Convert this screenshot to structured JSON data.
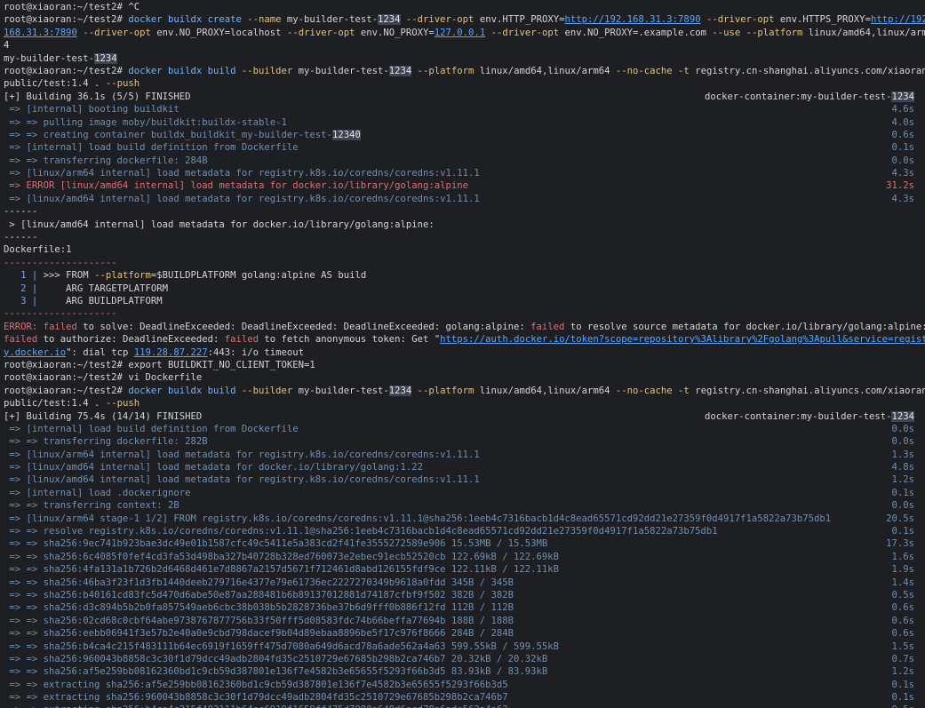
{
  "terminal": {
    "lines": [
      {
        "segs": [
          {
            "t": "root@xiaoran:~/test2# ",
            "c": "prompt"
          },
          {
            "t": "^C",
            "c": "plain"
          }
        ]
      },
      {
        "segs": [
          {
            "t": "root@xiaoran:~/test2# ",
            "c": "prompt"
          },
          {
            "t": "docker buildx create ",
            "c": "cmd"
          },
          {
            "t": "--name",
            "c": "opt"
          },
          {
            "t": " my-builder-test-",
            "c": "plain"
          },
          {
            "t": "1234",
            "c": "hl"
          },
          {
            "t": " ",
            "c": "plain"
          },
          {
            "t": "--driver-opt",
            "c": "opt"
          },
          {
            "t": " env.HTTP_PROXY=",
            "c": "plain"
          },
          {
            "t": "http://192.168.31.3:7890",
            "c": "url"
          },
          {
            "t": " ",
            "c": "plain"
          },
          {
            "t": "--driver-opt",
            "c": "opt"
          },
          {
            "t": " env.HTTPS_PROXY=",
            "c": "plain"
          },
          {
            "t": "http://192.",
            "c": "url"
          }
        ]
      },
      {
        "segs": [
          {
            "t": "168.31.3:7890",
            "c": "url"
          },
          {
            "t": " ",
            "c": "plain"
          },
          {
            "t": "--driver-opt",
            "c": "opt"
          },
          {
            "t": " env.NO_PROXY=localhost ",
            "c": "plain"
          },
          {
            "t": "--driver-opt",
            "c": "opt"
          },
          {
            "t": " env.NO_PROXY=",
            "c": "plain"
          },
          {
            "t": "127.0.0.1",
            "c": "url"
          },
          {
            "t": " ",
            "c": "plain"
          },
          {
            "t": "--driver-opt",
            "c": "opt"
          },
          {
            "t": " env.NO_PROXY=.example.com ",
            "c": "plain"
          },
          {
            "t": "--use",
            "c": "opt"
          },
          {
            "t": " ",
            "c": "plain"
          },
          {
            "t": "--platform",
            "c": "opt"
          },
          {
            "t": " linux/amd64,linux/arm6",
            "c": "plain"
          }
        ]
      },
      {
        "segs": [
          {
            "t": "4",
            "c": "plain"
          }
        ]
      },
      {
        "segs": [
          {
            "t": "my-builder-test-",
            "c": "plain"
          },
          {
            "t": "1234",
            "c": "hl"
          }
        ]
      },
      {
        "segs": [
          {
            "t": "root@xiaoran:~/test2# ",
            "c": "prompt"
          },
          {
            "t": "docker buildx build ",
            "c": "cmd"
          },
          {
            "t": "--builder",
            "c": "opt"
          },
          {
            "t": " my-builder-test-",
            "c": "plain"
          },
          {
            "t": "1234",
            "c": "hl"
          },
          {
            "t": " ",
            "c": "plain"
          },
          {
            "t": "--platform",
            "c": "opt"
          },
          {
            "t": " linux/amd64,linux/arm64 ",
            "c": "plain"
          },
          {
            "t": "--no-cache",
            "c": "opt"
          },
          {
            "t": " ",
            "c": "plain"
          },
          {
            "t": "-t",
            "c": "opt"
          },
          {
            "t": " registry.cn-shanghai.aliyuncs.com/xiaoran_",
            "c": "plain"
          }
        ]
      },
      {
        "segs": [
          {
            "t": "public/test:1.4 . ",
            "c": "plain"
          },
          {
            "t": "--push",
            "c": "opt"
          }
        ]
      },
      {
        "segs": [
          {
            "t": "[+] Building 36.1s (5/5) FINISHED",
            "c": "plain"
          }
        ],
        "right": [
          {
            "t": "docker-container:my-builder-test-",
            "c": "plain"
          },
          {
            "t": "1234",
            "c": "hl"
          }
        ]
      },
      {
        "segs": [
          {
            "t": " => [internal] booting buildkit",
            "c": "step"
          }
        ],
        "right": [
          {
            "t": "4.6s",
            "c": "time"
          }
        ]
      },
      {
        "segs": [
          {
            "t": " => => pulling image moby/buildkit:buildx-stable-1",
            "c": "step"
          }
        ],
        "right": [
          {
            "t": "4.0s",
            "c": "time"
          }
        ]
      },
      {
        "segs": [
          {
            "t": " => => creating container buildx_buildkit_my-builder-test-",
            "c": "step"
          },
          {
            "t": "12340",
            "c": "hl"
          }
        ],
        "right": [
          {
            "t": "0.6s",
            "c": "time"
          }
        ]
      },
      {
        "segs": [
          {
            "t": " => [internal] load build definition from Dockerfile",
            "c": "step"
          }
        ],
        "right": [
          {
            "t": "0.1s",
            "c": "time"
          }
        ]
      },
      {
        "segs": [
          {
            "t": " => => transferring dockerfile: 284B",
            "c": "step"
          }
        ],
        "right": [
          {
            "t": "0.0s",
            "c": "time"
          }
        ]
      },
      {
        "segs": [
          {
            "t": " => [linux/arm64 internal] load metadata for registry.k8s.io/coredns/coredns:v1.11.1",
            "c": "step"
          }
        ],
        "right": [
          {
            "t": "4.3s",
            "c": "time"
          }
        ]
      },
      {
        "segs": [
          {
            "t": " => ERROR [linux/amd64 internal] load metadata for docker.io/library/golang:alpine",
            "c": "err"
          }
        ],
        "right": [
          {
            "t": "31.2s",
            "c": "timeerr"
          }
        ]
      },
      {
        "segs": [
          {
            "t": " => [linux/amd64 internal] load metadata for registry.k8s.io/coredns/coredns:v1.11.1",
            "c": "step"
          }
        ],
        "right": [
          {
            "t": "4.3s",
            "c": "time"
          }
        ]
      },
      {
        "segs": [
          {
            "t": "------",
            "c": "plain"
          }
        ]
      },
      {
        "segs": [
          {
            "t": " > [linux/amd64 internal] load metadata for docker.io/library/golang:alpine:",
            "c": "plain"
          }
        ]
      },
      {
        "segs": [
          {
            "t": "------",
            "c": "plain"
          }
        ]
      },
      {
        "segs": [
          {
            "t": "Dockerfile:1",
            "c": "plain"
          }
        ]
      },
      {
        "segs": [
          {
            "t": "--------------------",
            "c": "err"
          }
        ]
      },
      {
        "segs": [
          {
            "t": "   1 | ",
            "c": "lnum"
          },
          {
            "t": ">>> FROM ",
            "c": "plain"
          },
          {
            "t": "--platform",
            "c": "opt"
          },
          {
            "t": "=$BUILDPLATFORM golang:alpine AS build",
            "c": "plain"
          }
        ]
      },
      {
        "segs": [
          {
            "t": "   2 | ",
            "c": "lnum"
          },
          {
            "t": "    ARG TARGETPLATFORM",
            "c": "plain"
          }
        ]
      },
      {
        "segs": [
          {
            "t": "   3 | ",
            "c": "lnum"
          },
          {
            "t": "    ARG BUILDPLATFORM",
            "c": "plain"
          }
        ]
      },
      {
        "segs": [
          {
            "t": "--------------------",
            "c": "err"
          }
        ]
      },
      {
        "segs": [
          {
            "t": "ERROR: failed",
            "c": "err"
          },
          {
            "t": " to solve: DeadlineExceeded: DeadlineExceeded: DeadlineExceeded: golang:alpine: ",
            "c": "plain"
          },
          {
            "t": "failed",
            "c": "err"
          },
          {
            "t": " to resolve source metadata for docker.io/library/golang:alpine: ",
            "c": "plain"
          },
          {
            "t": "f",
            "c": "err"
          }
        ]
      },
      {
        "segs": [
          {
            "t": "failed",
            "c": "err"
          },
          {
            "t": " to authorize: DeadlineExceeded: ",
            "c": "plain"
          },
          {
            "t": "failed",
            "c": "err"
          },
          {
            "t": " to fetch anonymous token: Get \"",
            "c": "plain"
          },
          {
            "t": "https://auth.docker.io/token?scope=repository%3Alibrary%2Fgolang%3Apull&service=registr",
            "c": "url"
          }
        ]
      },
      {
        "segs": [
          {
            "t": "y.docker.io",
            "c": "url"
          },
          {
            "t": "\": dial tcp ",
            "c": "plain"
          },
          {
            "t": "119.28.87.227",
            "c": "url"
          },
          {
            "t": ":443: i/o timeout",
            "c": "plain"
          }
        ]
      },
      {
        "segs": [
          {
            "t": "root@xiaoran:~/test2# ",
            "c": "prompt"
          },
          {
            "t": "export BUILDKIT_NO_CLIENT_TOKEN=1",
            "c": "plain"
          }
        ]
      },
      {
        "segs": [
          {
            "t": "root@xiaoran:~/test2# ",
            "c": "prompt"
          },
          {
            "t": "vi Dockerfile",
            "c": "plain"
          }
        ]
      },
      {
        "segs": [
          {
            "t": "root@xiaoran:~/test2# ",
            "c": "prompt"
          },
          {
            "t": "docker buildx build ",
            "c": "cmd"
          },
          {
            "t": "--builder",
            "c": "opt"
          },
          {
            "t": " my-builder-test-",
            "c": "plain"
          },
          {
            "t": "1234",
            "c": "hl"
          },
          {
            "t": " ",
            "c": "plain"
          },
          {
            "t": "--platform",
            "c": "opt"
          },
          {
            "t": " linux/amd64,linux/arm64 ",
            "c": "plain"
          },
          {
            "t": "--no-cache",
            "c": "opt"
          },
          {
            "t": " ",
            "c": "plain"
          },
          {
            "t": "-t",
            "c": "opt"
          },
          {
            "t": " registry.cn-shanghai.aliyuncs.com/xiaoran_",
            "c": "plain"
          }
        ]
      },
      {
        "segs": [
          {
            "t": "public/test:1.4 . ",
            "c": "plain"
          },
          {
            "t": "--push",
            "c": "opt"
          }
        ]
      },
      {
        "segs": [
          {
            "t": "[+] Building 75.4s (14/14) FINISHED",
            "c": "plain"
          }
        ],
        "right": [
          {
            "t": "docker-container:my-builder-test-",
            "c": "plain"
          },
          {
            "t": "1234",
            "c": "hl"
          }
        ]
      },
      {
        "segs": [
          {
            "t": " => [internal] load build definition from Dockerfile",
            "c": "step"
          }
        ],
        "right": [
          {
            "t": "0.0s",
            "c": "time"
          }
        ]
      },
      {
        "segs": [
          {
            "t": " => => transferring dockerfile: 282B",
            "c": "step"
          }
        ],
        "right": [
          {
            "t": "0.0s",
            "c": "time"
          }
        ]
      },
      {
        "segs": [
          {
            "t": " => [linux/arm64 internal] load metadata for registry.k8s.io/coredns/coredns:v1.11.1",
            "c": "step"
          }
        ],
        "right": [
          {
            "t": "1.3s",
            "c": "time"
          }
        ]
      },
      {
        "segs": [
          {
            "t": " => [linux/amd64 internal] load metadata for docker.io/library/golang:1.22",
            "c": "step"
          }
        ],
        "right": [
          {
            "t": "4.8s",
            "c": "time"
          }
        ]
      },
      {
        "segs": [
          {
            "t": " => [linux/amd64 internal] load metadata for registry.k8s.io/coredns/coredns:v1.11.1",
            "c": "step"
          }
        ],
        "right": [
          {
            "t": "1.2s",
            "c": "time"
          }
        ]
      },
      {
        "segs": [
          {
            "t": " => [internal] load .dockerignore",
            "c": "step"
          }
        ],
        "right": [
          {
            "t": "0.1s",
            "c": "time"
          }
        ]
      },
      {
        "segs": [
          {
            "t": " => => transferring context: 2B",
            "c": "step"
          }
        ],
        "right": [
          {
            "t": "0.0s",
            "c": "time"
          }
        ]
      },
      {
        "segs": [
          {
            "t": " => [linux/arm64 stage-1 1/2] FROM registry.k8s.io/coredns/coredns:v1.11.1@sha256:1eeb4c7316bacb1d4c8ead65571cd92dd21e27359f0d4917f1a5822a73b75db1",
            "c": "step"
          }
        ],
        "right": [
          {
            "t": "20.5s",
            "c": "time"
          }
        ]
      },
      {
        "segs": [
          {
            "t": " => => resolve registry.k8s.io/coredns/coredns:v1.11.1@sha256:1eeb4c7316bacb1d4c8ead65571cd92dd21e27359f0d4917f1a5822a73b75db1",
            "c": "step"
          }
        ],
        "right": [
          {
            "t": "0.1s",
            "c": "time"
          }
        ]
      },
      {
        "segs": [
          {
            "t": " => => sha256:9ec741b923bae3dc49e01b1587cfc49c5411e5a383cd2f41fe3555272589e906 15.53MB / 15.53MB",
            "c": "step"
          }
        ],
        "right": [
          {
            "t": "17.3s",
            "c": "time"
          }
        ]
      },
      {
        "segs": [
          {
            "t": " => => sha256:6c4085f0fef4cd3fa53d498ba327b40728b328ed760073e2ebec91ecb52520cb 122.69kB / 122.69kB",
            "c": "step"
          }
        ],
        "right": [
          {
            "t": "1.6s",
            "c": "time"
          }
        ]
      },
      {
        "segs": [
          {
            "t": " => => sha256:4fa131a1b726b2d6468d461e7d8867a2157d5671f712461d8abd126155fdf9ce 122.11kB / 122.11kB",
            "c": "step"
          }
        ],
        "right": [
          {
            "t": "1.9s",
            "c": "time"
          }
        ]
      },
      {
        "segs": [
          {
            "t": " => => sha256:46ba3f23f1d3fb1440deeb279716e4377e79e61736ec2227270349b9618a0fdd 345B / 345B",
            "c": "step"
          }
        ],
        "right": [
          {
            "t": "1.4s",
            "c": "time"
          }
        ]
      },
      {
        "segs": [
          {
            "t": " => => sha256:b40161cd83fc5d470d6abe50e87aa288481b6b89137012881d74187cfbf9f502 382B / 382B",
            "c": "step"
          }
        ],
        "right": [
          {
            "t": "0.5s",
            "c": "time"
          }
        ]
      },
      {
        "segs": [
          {
            "t": " => => sha256:d3c894b5b2b0fa857549aeb6cbc38b038b5b2828736be37b6d9fff0b886f12fd 112B / 112B",
            "c": "step"
          }
        ],
        "right": [
          {
            "t": "0.6s",
            "c": "time"
          }
        ]
      },
      {
        "segs": [
          {
            "t": " => => sha256:02cd68c0cbf64abe9738767877756b33f50fff5d08583fdc74b66beffa77694b 188B / 188B",
            "c": "step"
          }
        ],
        "right": [
          {
            "t": "0.6s",
            "c": "time"
          }
        ]
      },
      {
        "segs": [
          {
            "t": " => => sha256:eebb06941f3e57b2e40a0e9cbd798dacef9b04d89ebaa8896be5f17c976f8666 284B / 284B",
            "c": "step"
          }
        ],
        "right": [
          {
            "t": "0.6s",
            "c": "time"
          }
        ]
      },
      {
        "segs": [
          {
            "t": " => => sha256:b4ca4c215f483111b64ec6919f1659ff475d7080a649d6acd78a6ade562a4a63 599.55kB / 599.55kB",
            "c": "step"
          }
        ],
        "right": [
          {
            "t": "1.5s",
            "c": "time"
          }
        ]
      },
      {
        "segs": [
          {
            "t": " => => sha256:960043b8858c3c30f1d79dcc49adb2804fd35c2510729e67685b298b2ca746b7 20.32kB / 20.32kB",
            "c": "step"
          }
        ],
        "right": [
          {
            "t": "0.7s",
            "c": "time"
          }
        ]
      },
      {
        "segs": [
          {
            "t": " => => sha256:af5e259bb08162360bd1c9cb59d387801e136f7e4582b3e65655f5293f66b3d5 83.93kB / 83.93kB",
            "c": "step"
          }
        ],
        "right": [
          {
            "t": "1.2s",
            "c": "time"
          }
        ]
      },
      {
        "segs": [
          {
            "t": " => => extracting sha256:af5e259bb08162360bd1c9cb59d387801e136f7e4582b3e65655f5293f66b3d5",
            "c": "step"
          }
        ],
        "right": [
          {
            "t": "0.1s",
            "c": "time"
          }
        ]
      },
      {
        "segs": [
          {
            "t": " => => extracting sha256:960043b8858c3c30f1d79dcc49adb2804fd35c2510729e67685b298b2ca746b7",
            "c": "step"
          }
        ],
        "right": [
          {
            "t": "0.1s",
            "c": "time"
          }
        ]
      },
      {
        "segs": [
          {
            "t": " => => extracting sha256:b4ca4c215f483111b64ec6919f1659ff475d7080a649d6acd78a6ade562a4a63",
            "c": "step"
          }
        ],
        "right": [
          {
            "t": "0.5s",
            "c": "time"
          }
        ]
      }
    ]
  }
}
